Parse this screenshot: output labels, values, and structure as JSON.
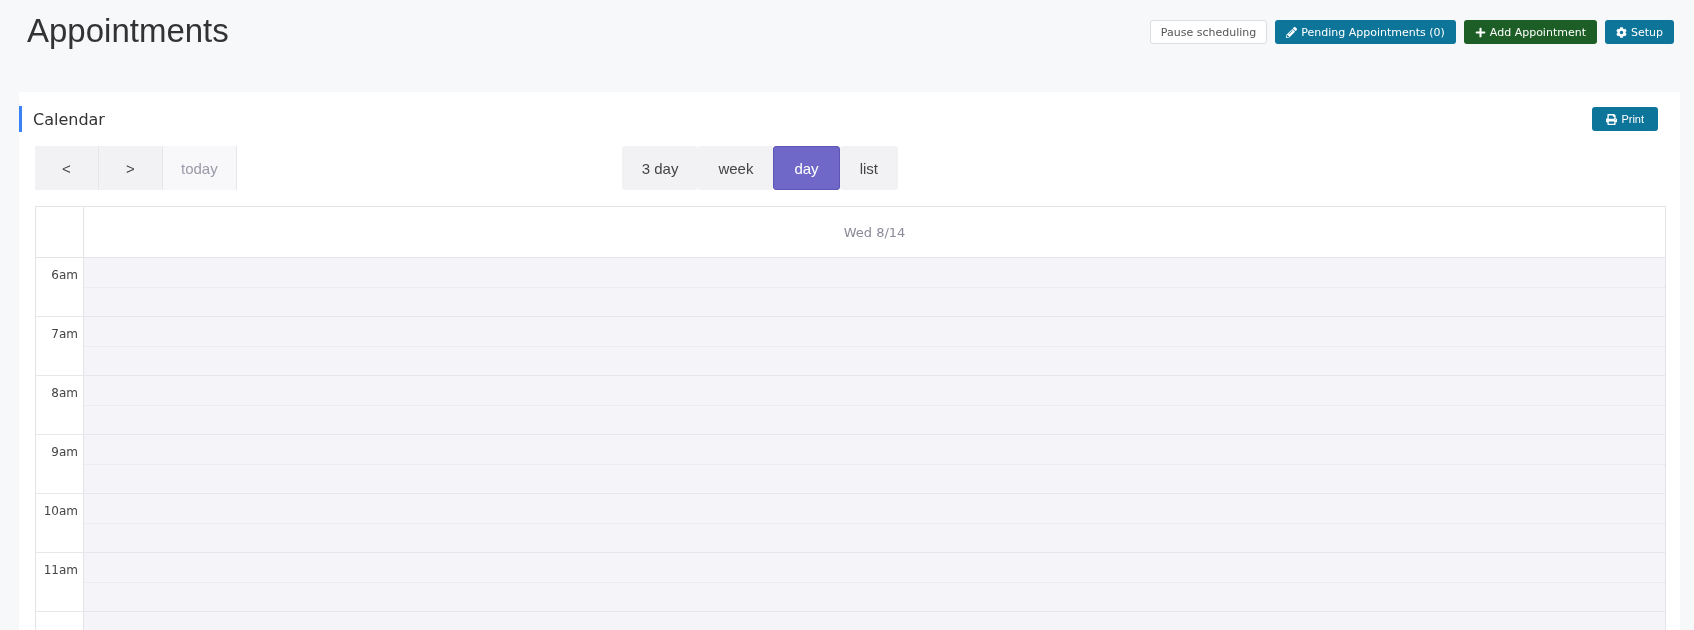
{
  "page": {
    "title": "Appointments"
  },
  "header_buttons": [
    {
      "kind": "plain",
      "label": "Pause scheduling"
    },
    {
      "kind": "pending",
      "label": "Pending Appointments (0)"
    },
    {
      "kind": "add",
      "label": "Add Appointment"
    },
    {
      "kind": "setup",
      "label": "Setup"
    }
  ],
  "calendar": {
    "title": "Calendar",
    "print_label": "Print",
    "nav": [
      {
        "label": "<",
        "disabled": false
      },
      {
        "label": ">",
        "disabled": false
      },
      {
        "label": "today",
        "disabled": true
      }
    ],
    "views": [
      {
        "label": "3 day",
        "selected": false
      },
      {
        "label": "week",
        "selected": false
      },
      {
        "label": "day",
        "selected": true
      },
      {
        "label": "list",
        "selected": false
      }
    ],
    "column_header": "Wed 8/14",
    "hours": [
      "6am",
      "7am",
      "8am",
      "9am",
      "10am",
      "11am"
    ]
  }
}
